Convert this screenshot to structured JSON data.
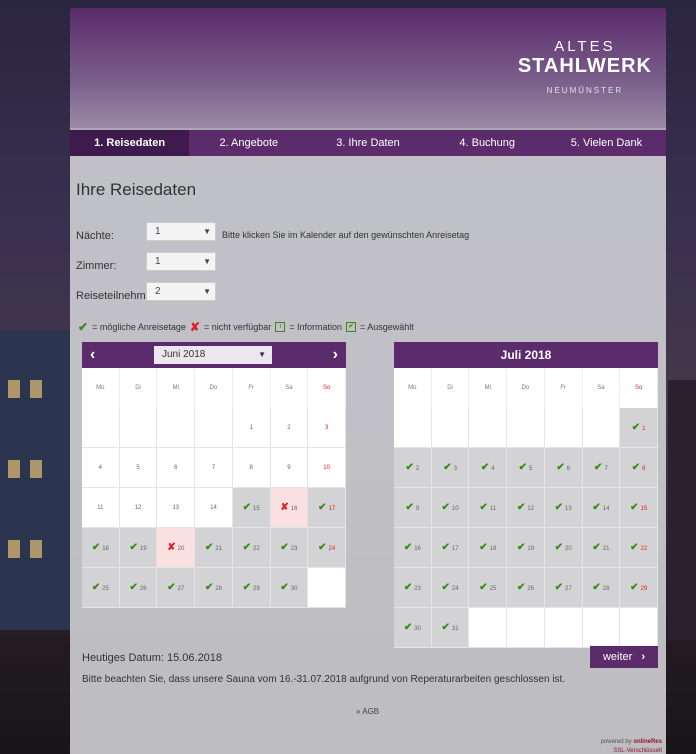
{
  "brand": {
    "line1": "ALTES",
    "line2": "STAHLWERK",
    "line3": "NEUMÜNSTER"
  },
  "steps": [
    "1. Reisedaten",
    "2. Angebote",
    "3. Ihre Daten",
    "4. Buchung",
    "5. Vielen Dank"
  ],
  "title": "Ihre Reisedaten",
  "form": {
    "naechte_label": "Nächte:",
    "naechte_value": "1",
    "zimmer_label": "Zimmer:",
    "zimmer_value": "1",
    "teilnehmer_label": "Reiseteilnehmer:",
    "teilnehmer_value": "2",
    "hint": "Bitte klicken Sie im Kalender auf den gewünschten Anreisetag"
  },
  "legend": {
    "possible": "= mögliche Anreisetage",
    "unavailable": "= nicht verfügbar",
    "info": "= Information",
    "selected": "= Ausgewählt"
  },
  "weekdays": [
    "Mo",
    "Di",
    "Mi",
    "Do",
    "Fr",
    "Sa",
    "So"
  ],
  "cal1": {
    "month": "Juni 2018",
    "cells": [
      [
        "",
        "blank"
      ],
      [
        "",
        "blank"
      ],
      [
        "",
        "blank"
      ],
      [
        "",
        "blank"
      ],
      [
        "1",
        "blank"
      ],
      [
        "2",
        "blank"
      ],
      [
        "3",
        "blank"
      ],
      [
        "4",
        "blank"
      ],
      [
        "5",
        "blank"
      ],
      [
        "6",
        "blank"
      ],
      [
        "7",
        "blank"
      ],
      [
        "8",
        "blank"
      ],
      [
        "9",
        "blank"
      ],
      [
        "10",
        "blank"
      ],
      [
        "11",
        "blank"
      ],
      [
        "12",
        "blank"
      ],
      [
        "13",
        "blank"
      ],
      [
        "14",
        "blank"
      ],
      [
        "15",
        "avail"
      ],
      [
        "16",
        "na"
      ],
      [
        "17",
        "avail"
      ],
      [
        "18",
        "avail"
      ],
      [
        "19",
        "avail"
      ],
      [
        "20",
        "na"
      ],
      [
        "21",
        "avail"
      ],
      [
        "22",
        "avail"
      ],
      [
        "23",
        "avail"
      ],
      [
        "24",
        "avail"
      ],
      [
        "25",
        "avail"
      ],
      [
        "26",
        "avail"
      ],
      [
        "27",
        "avail"
      ],
      [
        "28",
        "avail"
      ],
      [
        "29",
        "avail"
      ],
      [
        "30",
        "avail"
      ],
      [
        "",
        "blank"
      ]
    ]
  },
  "cal2": {
    "month": "Juli 2018",
    "cells": [
      [
        "",
        "blank"
      ],
      [
        "",
        "blank"
      ],
      [
        "",
        "blank"
      ],
      [
        "",
        "blank"
      ],
      [
        "",
        "blank"
      ],
      [
        "",
        "blank"
      ],
      [
        "1",
        "avail"
      ],
      [
        "2",
        "avail"
      ],
      [
        "3",
        "avail"
      ],
      [
        "4",
        "avail"
      ],
      [
        "5",
        "avail"
      ],
      [
        "6",
        "avail"
      ],
      [
        "7",
        "avail"
      ],
      [
        "8",
        "avail"
      ],
      [
        "9",
        "avail"
      ],
      [
        "10",
        "avail"
      ],
      [
        "11",
        "avail"
      ],
      [
        "12",
        "avail"
      ],
      [
        "13",
        "avail"
      ],
      [
        "14",
        "avail"
      ],
      [
        "15",
        "avail"
      ],
      [
        "16",
        "avail"
      ],
      [
        "17",
        "avail"
      ],
      [
        "18",
        "avail"
      ],
      [
        "19",
        "avail"
      ],
      [
        "20",
        "avail"
      ],
      [
        "21",
        "avail"
      ],
      [
        "22",
        "avail"
      ],
      [
        "23",
        "avail"
      ],
      [
        "24",
        "avail"
      ],
      [
        "25",
        "avail"
      ],
      [
        "26",
        "avail"
      ],
      [
        "27",
        "avail"
      ],
      [
        "28",
        "avail"
      ],
      [
        "29",
        "avail"
      ],
      [
        "30",
        "avail"
      ],
      [
        "31",
        "avail"
      ],
      [
        "",
        "blank"
      ],
      [
        "",
        "blank"
      ],
      [
        "",
        "blank"
      ],
      [
        "",
        "blank"
      ],
      [
        "",
        "blank"
      ]
    ]
  },
  "today": "Heutiges Datum: 15.06.2018",
  "notice": "Bitte beachten Sie, dass unsere Sauna vom 16.-31.07.2018 aufgrund von Reperaturarbeiten geschlossen ist.",
  "weiter": "weiter",
  "agb": "» AGB",
  "powered": {
    "p1": "powered by ",
    "p1b": "onlineRes",
    "p2": "SSL-Verschlüsselt"
  },
  "colors": {
    "primary": "#5b2b6b",
    "check": "#3a8a1a",
    "unavailable": "#d22222"
  }
}
